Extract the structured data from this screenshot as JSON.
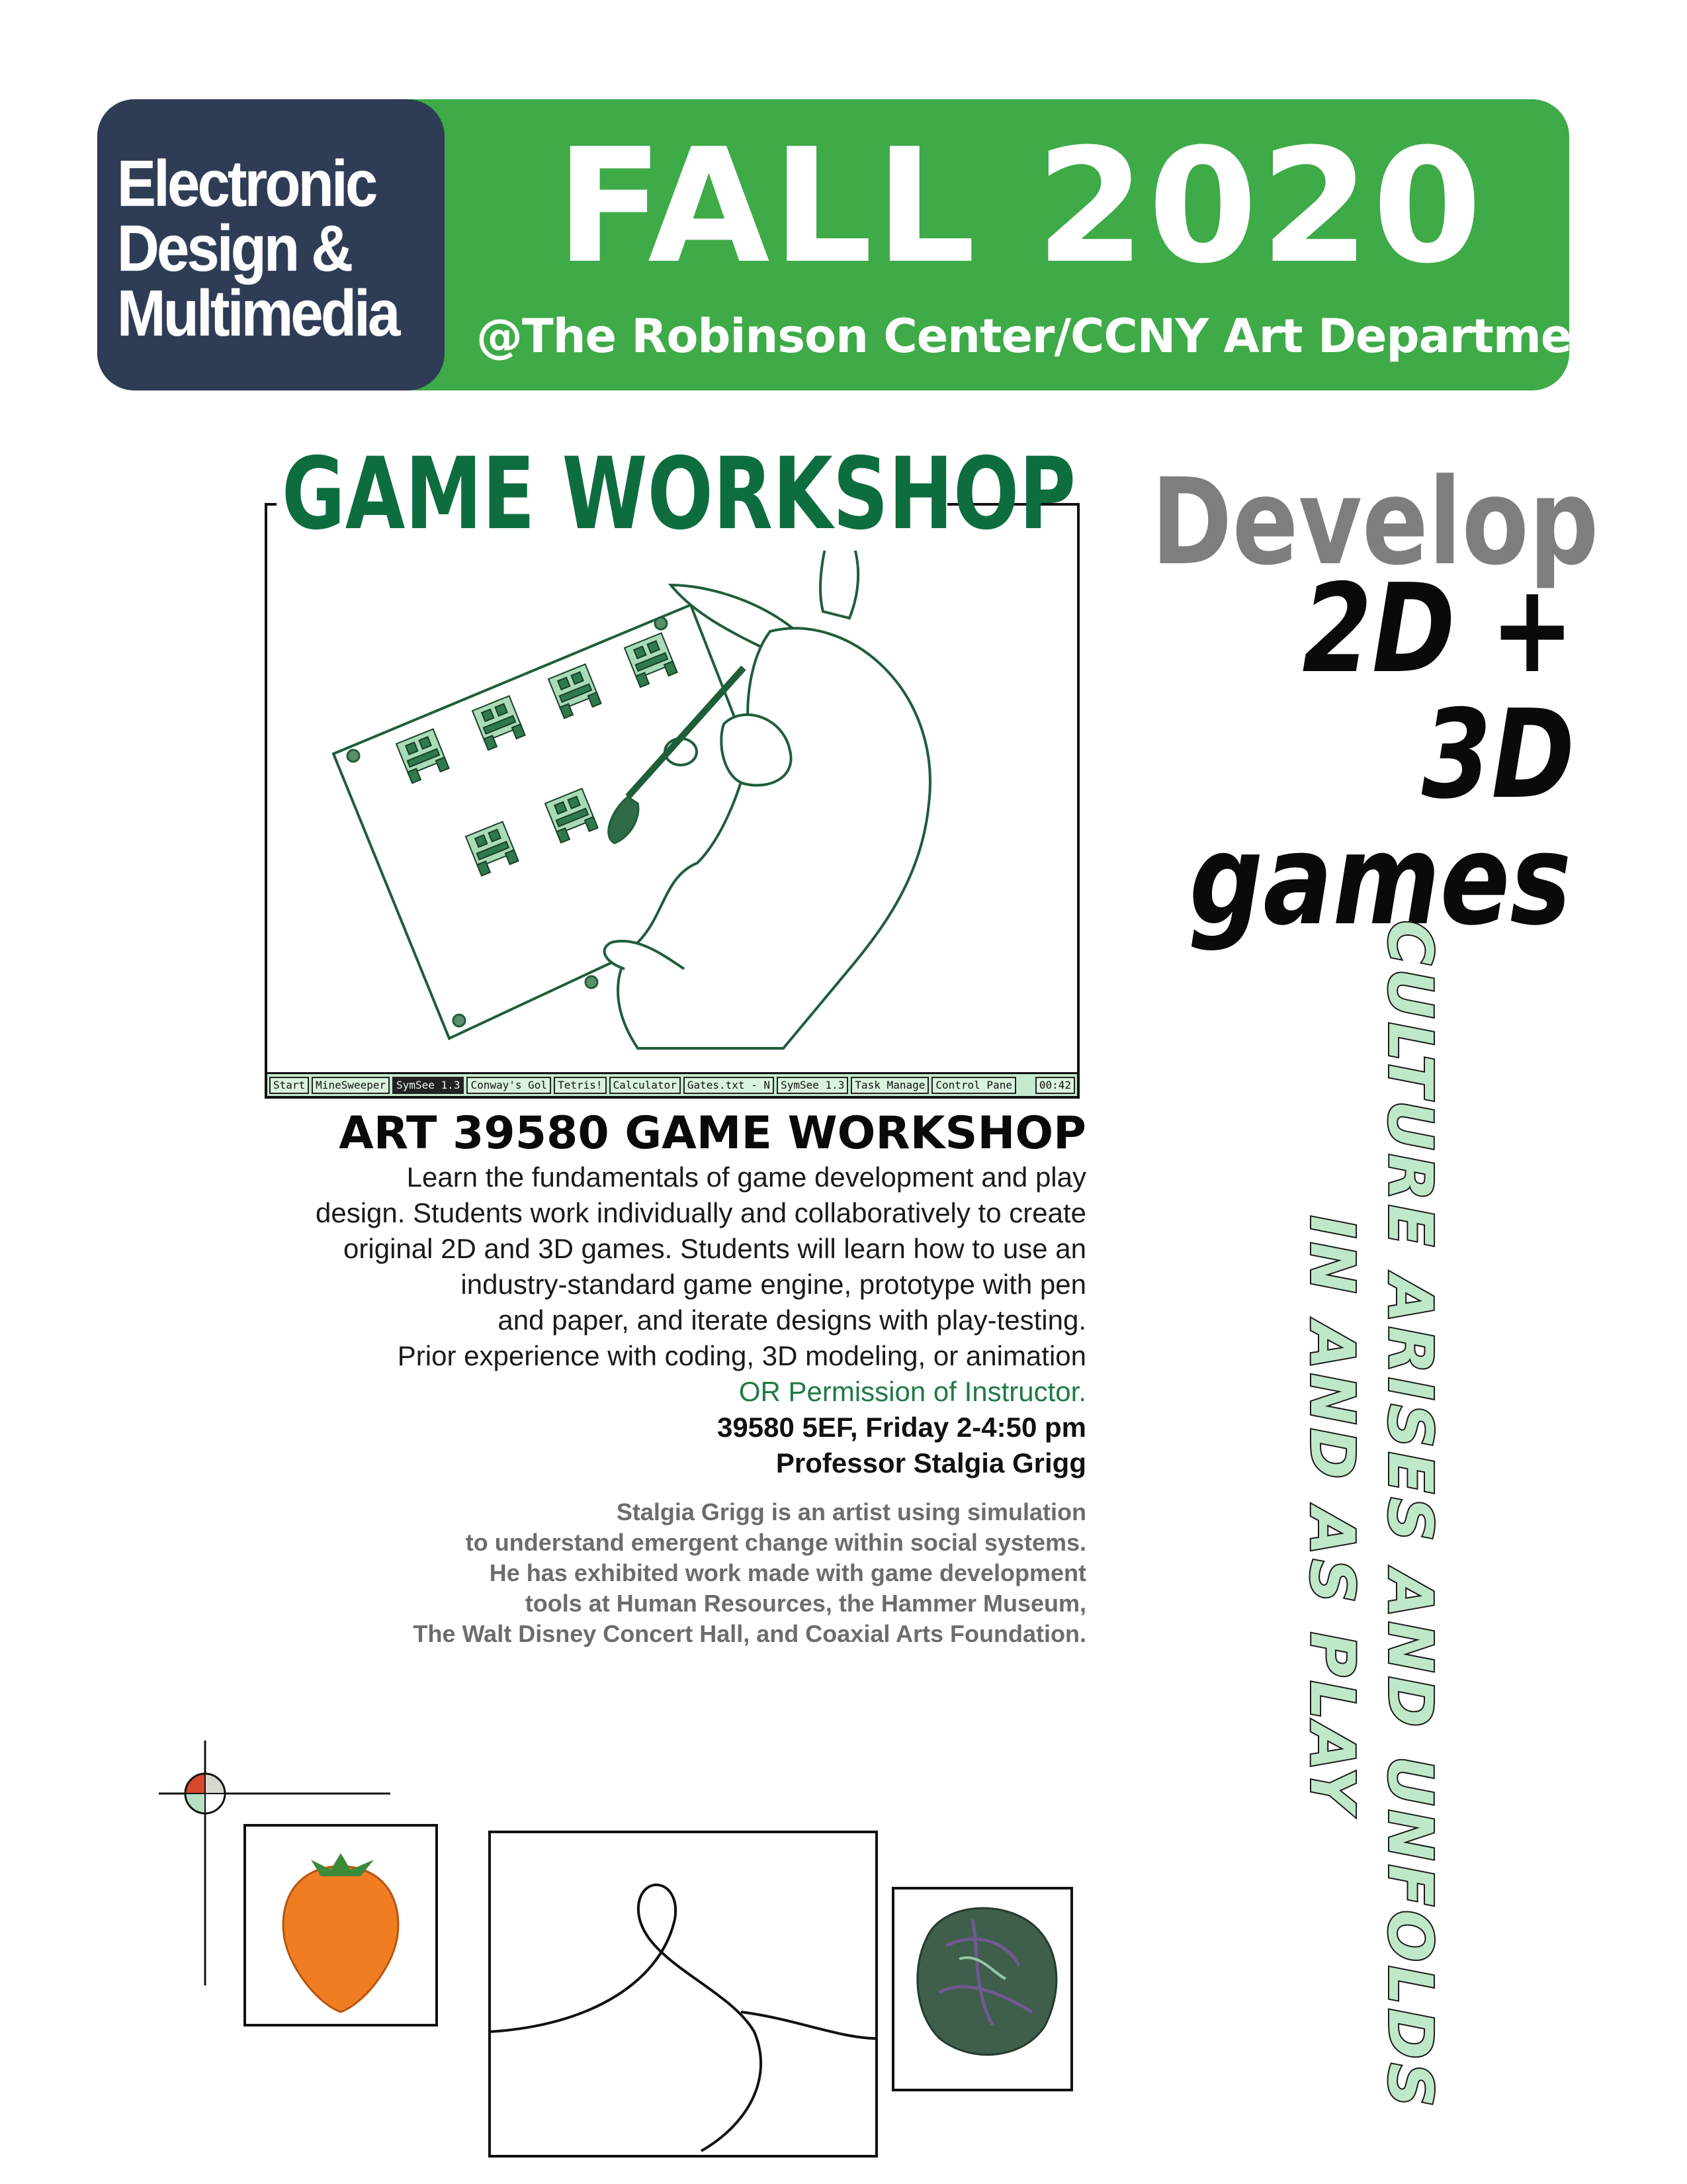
{
  "header": {
    "department_lines": [
      "Electronic",
      "Design &",
      "Multimedia"
    ],
    "season": "FALL 2020",
    "venue": "@The Robinson Center/CCNY Art Department"
  },
  "workshop_title": "GAME WORKSHOP",
  "illustration": {
    "subject": "rabbit-painting-pixel-sprites",
    "taskbar_items": [
      "Start",
      "MineSweeper",
      "SymSee 1.3",
      "Conway's Gol",
      "Tetris!",
      "Calculator",
      "Gates.txt - N",
      "SymSee 1.3",
      "Task Manage",
      "Control Pane"
    ],
    "clock": "00:42"
  },
  "headline": {
    "develop": "Develop",
    "line2": "2D +",
    "line3": "3D",
    "line4": "games"
  },
  "course": {
    "title": "ART 39580 GAME WORKSHOP",
    "description_lines": [
      "Learn the fundamentals of game development and play",
      "design. Students work individually and collaboratively to create",
      "original 2D and 3D games. Students will learn how to use an",
      "industry-standard game engine, prototype with pen",
      "and paper, and iterate designs with play-testing.",
      "Prior experience with coding, 3D modeling, or animation"
    ],
    "prerequisite": "OR Permission of Instructor.",
    "schedule": "39580 5EF, Friday 2-4:50 pm",
    "instructor": "Professor Stalgia Grigg"
  },
  "bio_lines": [
    "Stalgia Grigg is an artist using simulation",
    "to understand emergent change within social systems.",
    "He has exhibited work made with game development",
    "tools at Human Resources, the Hammer Museum,",
    "The Walt Disney Concert Hall, and Coaxial Arts Foundation."
  ],
  "slogan_lines": [
    "CULTURE ARISES AND UNFOLDS",
    "IN AND AS PLAY"
  ],
  "colors": {
    "banner_green": "#3faa48",
    "dept_navy": "#2e3c55",
    "title_green": "#0e6d3e",
    "develop_gray": "#7e7e7e",
    "slogan_fill": "#bfe8c8",
    "prereq_green": "#1f7a45"
  },
  "bottom_icons": [
    "registration-mark-icon",
    "strawberry-icon",
    "loop-curve-icon",
    "rock-icon"
  ]
}
